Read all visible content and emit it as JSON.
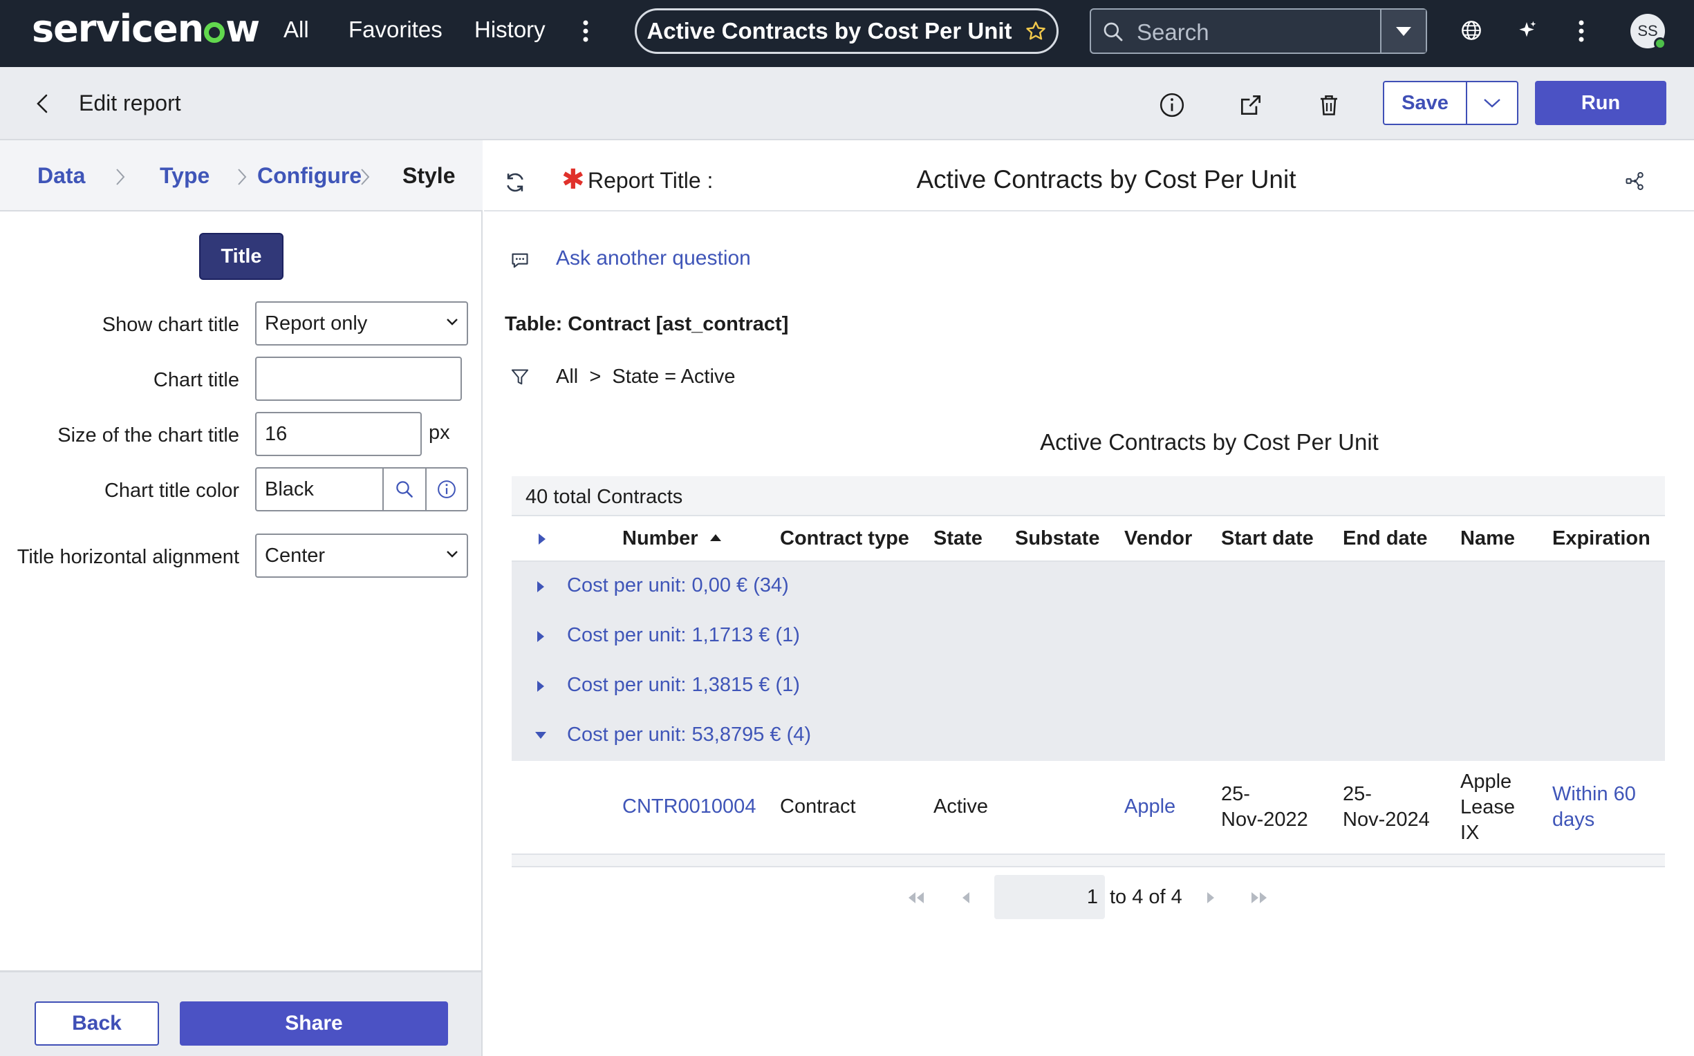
{
  "topnav": {
    "logo_pre": "servicen",
    "logo_post": "w",
    "links": {
      "all": "All",
      "favorites": "Favorites",
      "history": "History"
    },
    "title_pill": "Active Contracts by Cost Per Unit",
    "search_placeholder": "Search",
    "avatar_initials": "SS"
  },
  "header": {
    "title": "Edit report",
    "save_label": "Save",
    "run_label": "Run"
  },
  "steps": [
    "Data",
    "Type",
    "Configure",
    "Style"
  ],
  "style_panel": {
    "tab_label": "Title",
    "show_chart_title_label": "Show chart title",
    "show_chart_title_value": "Report only",
    "chart_title_label": "Chart title",
    "chart_title_value": "",
    "size_label": "Size of the chart title",
    "size_value": "16",
    "size_unit": "px",
    "color_label": "Chart title color",
    "color_value": "Black",
    "alignment_label": "Title horizontal alignment",
    "alignment_value": "Center"
  },
  "footer": {
    "back_label": "Back",
    "share_label": "Share"
  },
  "report": {
    "title_label": "Report Title :",
    "title_value": "Active Contracts by Cost Per Unit",
    "ask_link": "Ask another question",
    "table_name": "Table: Contract [ast_contract]",
    "filter": "All  >  State = Active",
    "chart_title": "Active Contracts by Cost Per Unit"
  },
  "list": {
    "total": "40 total Contracts",
    "columns": [
      "Number",
      "Contract type",
      "State",
      "Substate",
      "Vendor",
      "Start date",
      "End date",
      "Name",
      "Expiration"
    ],
    "groups": [
      {
        "label": "Cost per unit: 0,00 € (34)",
        "expanded": false
      },
      {
        "label": "Cost per unit: 1,1713 € (1)",
        "expanded": false
      },
      {
        "label": "Cost per unit: 1,3815 € (1)",
        "expanded": false
      },
      {
        "label": "Cost per unit: 53,8795 € (4)",
        "expanded": true
      }
    ],
    "row": {
      "number": "CNTR0010004",
      "contract_type": "Contract",
      "state": "Active",
      "substate": "",
      "vendor": "Apple",
      "start_date_1": "25-",
      "start_date_2": "Nov-2022",
      "end_date_1": "25-",
      "end_date_2": "Nov-2024",
      "name_1": "Apple",
      "name_2": "Lease",
      "name_3": "IX",
      "expiration_1": "Within 60",
      "expiration_2": "days"
    }
  },
  "pager": {
    "page": "1",
    "range": "to 4 of 4"
  },
  "colors": {
    "nav_bg": "#1c2430",
    "primary": "#4b52c4",
    "link": "#3f55b8",
    "logo_accent": "#62d84e",
    "required": "#e0312b"
  }
}
